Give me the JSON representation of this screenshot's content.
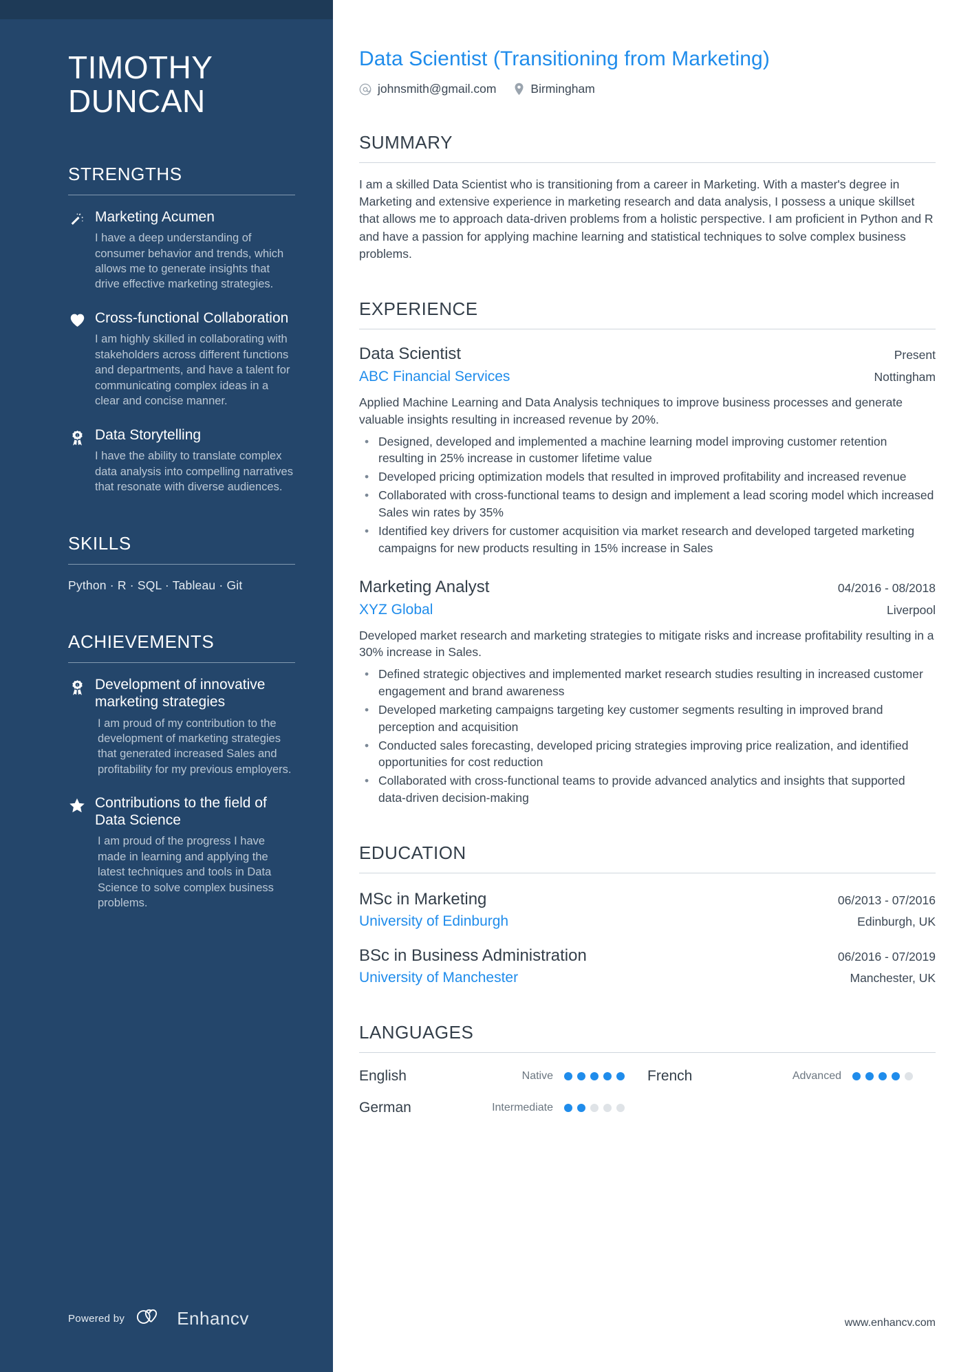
{
  "colors": {
    "sidebar_bg": "#24466b",
    "accent": "#1f8ceb",
    "text": "#3b4754",
    "heading": "#333e49"
  },
  "sidebar": {
    "name_line1": "TIMOTHY",
    "name_line2": "DUNCAN",
    "strengths_heading": "STRENGTHS",
    "strengths": [
      {
        "icon": "magic-wand-icon",
        "title": "Marketing Acumen",
        "desc": "I have a deep understanding of consumer behavior and trends, which allows me to generate insights that drive effective marketing strategies."
      },
      {
        "icon": "heart-icon",
        "title": "Cross-functional Collaboration",
        "desc": "I am highly skilled in collaborating with stakeholders across different functions and departments, and have a talent for communicating complex ideas in a clear and concise manner."
      },
      {
        "icon": "award-ribbon-icon",
        "title": "Data Storytelling",
        "desc": "I have the ability to translate complex data analysis into compelling narratives that resonate with diverse audiences."
      }
    ],
    "skills_heading": "SKILLS",
    "skills_line": "Python ·  R  · SQL · Tableau · Git",
    "achievements_heading": "ACHIEVEMENTS",
    "achievements": [
      {
        "icon": "award-ribbon-icon",
        "title": "Development of innovative marketing strategies",
        "desc": "I am proud of my contribution to the development of marketing strategies that generated increased Sales and profitability for my previous employers."
      },
      {
        "icon": "star-icon",
        "title": "Contributions to the field of Data Science",
        "desc": "I am proud of the progress I have made in learning and applying the latest techniques and tools in Data Science to solve complex business problems."
      }
    ],
    "powered_by_label": "Powered by",
    "brand_name": "Enhancv"
  },
  "main": {
    "headline": "Data Scientist (Transitioning from Marketing)",
    "contacts": [
      {
        "icon": "at-sign-icon",
        "value": "johnsmith@gmail.com"
      },
      {
        "icon": "location-pin-icon",
        "value": "Birmingham"
      }
    ],
    "summary": {
      "heading": "SUMMARY",
      "text": "I am a skilled Data Scientist who is transitioning from a career in Marketing. With a master's degree in Marketing and extensive experience in marketing research and data analysis, I possess a unique skillset that allows me to approach data-driven problems from a holistic perspective. I am proficient in Python and R and have a passion for applying machine learning and statistical techniques to solve complex business problems."
    },
    "experience": {
      "heading": "EXPERIENCE",
      "entries": [
        {
          "title": "Data Scientist",
          "date": "Present",
          "org": "ABC Financial Services",
          "location": "Nottingham",
          "desc": "Applied Machine Learning and Data Analysis techniques to improve business processes and generate valuable insights resulting in increased revenue by 20%.",
          "bullets": [
            "Designed, developed and implemented a machine learning model improving customer retention resulting in 25% increase in customer lifetime value",
            "Developed pricing optimization models that resulted in improved profitability and increased revenue",
            "Collaborated with cross-functional teams to design and implement a lead scoring model which increased Sales win rates by 35%",
            "Identified key drivers for customer acquisition via market research and developed targeted marketing campaigns for new products resulting in 15% increase in Sales"
          ]
        },
        {
          "title": "Marketing Analyst",
          "date": "04/2016 - 08/2018",
          "org": "XYZ Global",
          "location": "Liverpool",
          "desc": "Developed market research and marketing strategies to mitigate risks and increase profitability resulting in a 30% increase in Sales.",
          "bullets": [
            "Defined strategic objectives and implemented market research studies resulting in increased customer engagement and brand awareness",
            "Developed marketing campaigns targeting key customer segments resulting in improved brand perception and acquisition",
            "Conducted sales forecasting, developed pricing strategies improving price realization, and identified opportunities for cost reduction",
            "Collaborated with cross-functional teams to provide advanced analytics and insights that supported data-driven decision-making"
          ]
        }
      ]
    },
    "education": {
      "heading": "EDUCATION",
      "entries": [
        {
          "title": "MSc in Marketing",
          "date": "06/2013 - 07/2016",
          "org": "University of Edinburgh",
          "location": "Edinburgh, UK"
        },
        {
          "title": "BSc in Business Administration",
          "date": "06/2016 - 07/2019",
          "org": "University of Manchester",
          "location": "Manchester, UK"
        }
      ]
    },
    "languages": {
      "heading": "LANGUAGES",
      "max_dots": 5,
      "items": [
        {
          "name": "English",
          "level": "Native",
          "rating": 5
        },
        {
          "name": "French",
          "level": "Advanced",
          "rating": 4
        },
        {
          "name": "German",
          "level": "Intermediate",
          "rating": 2
        }
      ]
    },
    "website": "www.enhancv.com"
  }
}
